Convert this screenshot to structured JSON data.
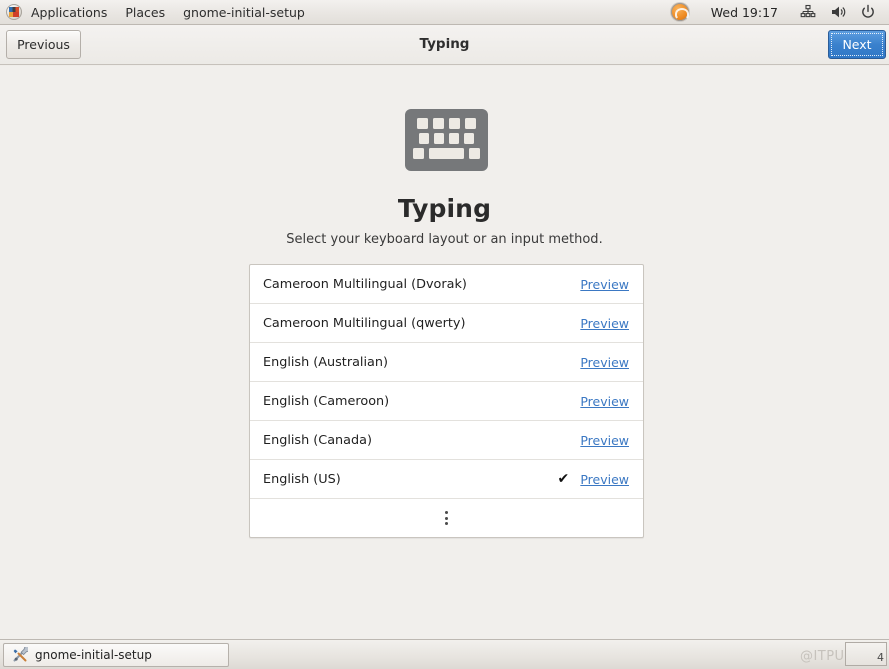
{
  "menubar": {
    "logo_icon": "fedora-logo-icon",
    "items": [
      {
        "label": "Applications"
      },
      {
        "label": "Places"
      },
      {
        "label": "gnome-initial-setup"
      }
    ],
    "tray": {
      "avatar_icon": "user-avatar-icon",
      "clock": "Wed 19:17",
      "network_icon": "network-icon",
      "volume_icon": "volume-icon",
      "power_icon": "power-icon"
    }
  },
  "headerbar": {
    "previous_label": "Previous",
    "title": "Typing",
    "next_label": "Next"
  },
  "main": {
    "hero_icon": "keyboard-icon",
    "title": "Typing",
    "subtitle": "Select your keyboard layout or an input method.",
    "preview_label": "Preview",
    "check_glyph": "✔",
    "rows": [
      {
        "label": "Cameroon Multilingual (Dvorak)",
        "selected": false
      },
      {
        "label": "Cameroon Multilingual (qwerty)",
        "selected": false
      },
      {
        "label": "English (Australian)",
        "selected": false
      },
      {
        "label": "English (Cameroon)",
        "selected": false
      },
      {
        "label": "English (Canada)",
        "selected": false
      },
      {
        "label": "English (US)",
        "selected": true
      }
    ],
    "more_icon": "more-dots-icon"
  },
  "taskbar": {
    "window_icon": "tools-icon",
    "window_label": "gnome-initial-setup",
    "watermark": "@ITPUB博客",
    "workspace_number": "4"
  },
  "colors": {
    "background": "#f1efec",
    "accent_blue": "#3a81cd",
    "link_blue": "#3b78c3",
    "icon_gray": "#76787a",
    "list_white": "#ffffff",
    "border": "#c9c5bf"
  }
}
